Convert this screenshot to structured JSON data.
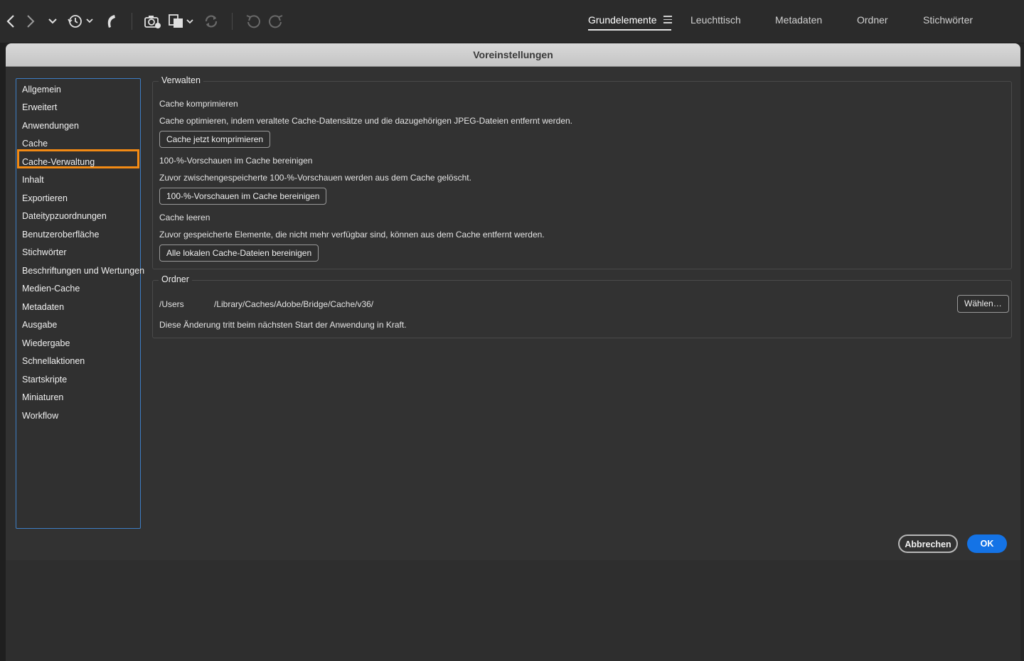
{
  "toolbar": {
    "icons": [
      "back-icon",
      "forward-icon",
      "chevron-down-icon",
      "recent-history-icon",
      "boomerang-icon",
      "camera-get-photos-icon",
      "copy-stack-icon",
      "refresh-icon",
      "undo-rotate-icon",
      "redo-rotate-icon"
    ],
    "workspaces": [
      "Grundelemente",
      "Leuchttisch",
      "Metadaten",
      "Ordner",
      "Stichwörter"
    ],
    "active_workspace": "Grundelemente"
  },
  "dialog": {
    "title": "Voreinstellungen",
    "categories": [
      "Allgemein",
      "Erweitert",
      "Anwendungen",
      "Cache",
      "Cache-Verwaltung",
      "Inhalt",
      "Exportieren",
      "Dateitypzuordnungen",
      "Benutzeroberfläche",
      "Stichwörter",
      "Beschriftungen und Wertungen",
      "Medien-Cache",
      "Metadaten",
      "Ausgabe",
      "Wiedergabe",
      "Schnellaktionen",
      "Startskripte",
      "Miniaturen",
      "Workflow"
    ],
    "selected_category": "Cache-Verwaltung",
    "highlight_color": "#f28a14",
    "manage": {
      "legend": "Verwalten",
      "compact_heading": "Cache komprimieren",
      "compact_desc": "Cache optimieren, indem veraltete Cache-Datensätze und die dazugehörigen JPEG-Dateien entfernt werden.",
      "compact_button": "Cache jetzt komprimieren",
      "previews_heading": "100-%-Vorschauen im Cache bereinigen",
      "previews_desc": "Zuvor zwischengespeicherte 100-%-Vorschauen werden aus dem Cache gelöscht.",
      "previews_button": "100-%-Vorschauen im Cache bereinigen",
      "clear_heading": "Cache leeren",
      "clear_desc": "Zuvor gespeicherte Elemente, die nicht mehr verfügbar sind, können aus dem Cache entfernt werden.",
      "clear_button": "Alle lokalen Cache-Dateien bereinigen"
    },
    "folder": {
      "legend": "Ordner",
      "path_prefix": "/Users",
      "path_suffix": "/Library/Caches/Adobe/Bridge/Cache/v36/",
      "choose_button": "Wählen…",
      "note": "Diese Änderung tritt beim nächsten Start der Anwendung in Kraft."
    },
    "cancel_label": "Abbrechen",
    "ok_label": "OK",
    "accent_color": "#1473e6"
  }
}
